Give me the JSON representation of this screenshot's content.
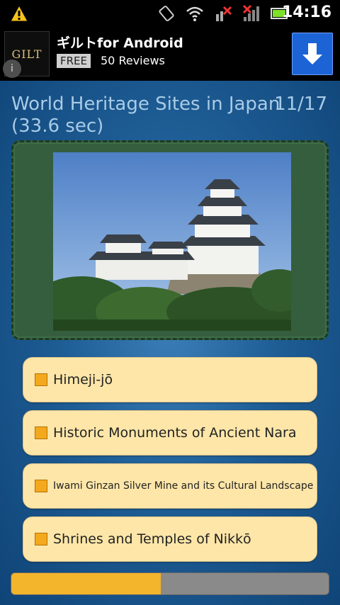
{
  "status_bar": {
    "time": "14:16"
  },
  "ad": {
    "logo_text": "GILT",
    "title": "ギルトfor Android",
    "free_label": "FREE",
    "reviews": "50 Reviews"
  },
  "quiz": {
    "title": "World Heritage Sites in Japan",
    "counter": "11/17",
    "timer": "(33.6 sec)",
    "answers": [
      {
        "label": "Himeji-jō"
      },
      {
        "label": "Historic Monuments of Ancient Nara"
      },
      {
        "label": "Iwami Ginzan Silver Mine and its Cultural Landscape"
      },
      {
        "label": "Shrines and Temples of Nikkō"
      }
    ],
    "progress": 0.47
  },
  "colors": {
    "accent": "#f2b52c",
    "answer_bg": "#fde6a8",
    "frame": "#355e3e"
  }
}
